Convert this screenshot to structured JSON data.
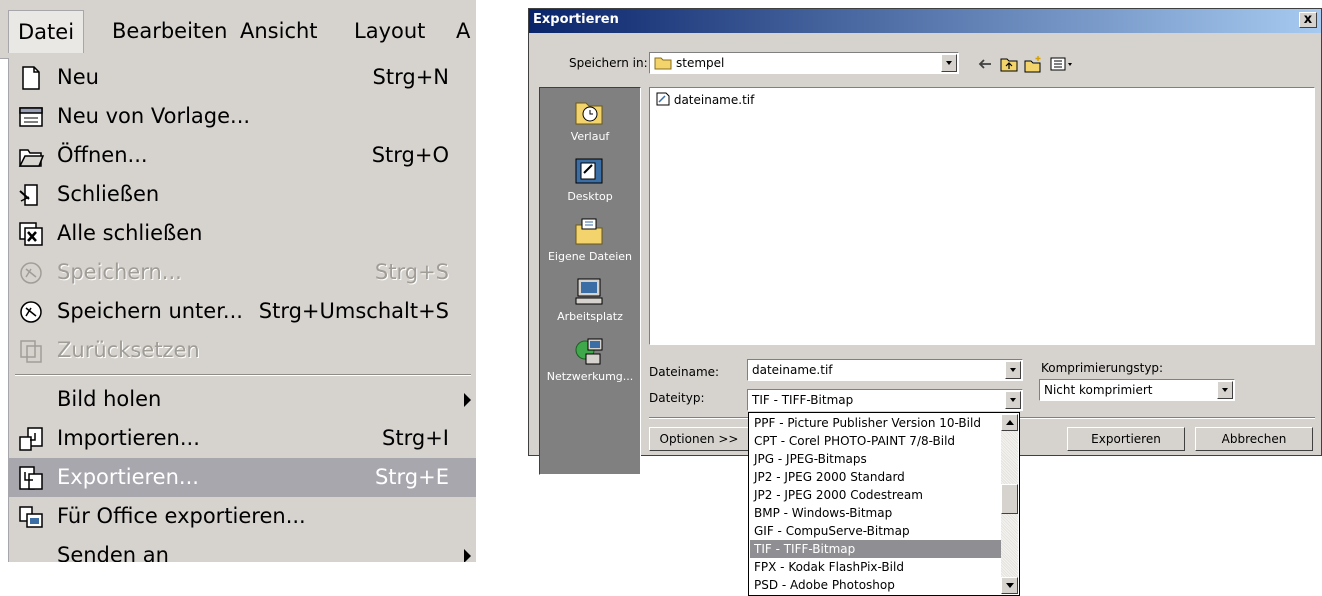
{
  "menubar": {
    "items": [
      {
        "label": "Datei"
      },
      {
        "label": "Bearbeiten"
      },
      {
        "label": "Ansicht"
      },
      {
        "label": "Layout"
      },
      {
        "label": "A"
      }
    ]
  },
  "menu": {
    "items": [
      {
        "icon": "new-document-icon",
        "label": "Neu",
        "shortcut": "Strg+N",
        "disabled": false
      },
      {
        "icon": "template-icon",
        "label": "Neu von Vorlage...",
        "shortcut": "",
        "disabled": false
      },
      {
        "icon": "open-folder-icon",
        "label": "Öffnen...",
        "shortcut": "Strg+O",
        "disabled": false
      },
      {
        "icon": "close-document-icon",
        "label": "Schließen",
        "shortcut": "",
        "disabled": false
      },
      {
        "icon": "close-all-icon",
        "label": "Alle schließen",
        "shortcut": "",
        "disabled": false
      },
      {
        "icon": "save-icon",
        "label": "Speichern...",
        "shortcut": "Strg+S",
        "disabled": true
      },
      {
        "icon": "save-as-icon",
        "label": "Speichern unter...",
        "shortcut": "Strg+Umschalt+S",
        "disabled": false
      },
      {
        "icon": "revert-icon",
        "label": "Zurücksetzen",
        "shortcut": "",
        "disabled": true
      },
      {
        "icon": "",
        "label": "Bild holen",
        "shortcut": "",
        "disabled": false,
        "submenu": true
      },
      {
        "icon": "import-icon",
        "label": "Importieren...",
        "shortcut": "Strg+I",
        "disabled": false
      },
      {
        "icon": "export-icon",
        "label": "Exportieren...",
        "shortcut": "Strg+E",
        "disabled": false,
        "highlighted": true
      },
      {
        "icon": "office-export-icon",
        "label": "Für Office exportieren...",
        "shortcut": "",
        "disabled": false
      },
      {
        "icon": "",
        "label": "Senden an",
        "shortcut": "",
        "disabled": false,
        "submenu": true
      }
    ]
  },
  "dialog": {
    "title": "Exportieren",
    "close_label": "x",
    "save_in_label": "Speichern in:",
    "save_in_value": "stempel",
    "places": [
      {
        "label": "Verlauf",
        "icon": "history-icon"
      },
      {
        "label": "Desktop",
        "icon": "desktop-icon"
      },
      {
        "label": "Eigene Dateien",
        "icon": "my-documents-icon"
      },
      {
        "label": "Arbeitsplatz",
        "icon": "my-computer-icon"
      },
      {
        "label": "Netzwerkumg...",
        "icon": "network-icon"
      }
    ],
    "files": [
      {
        "name": "dateiname.tif"
      }
    ],
    "filename_label": "Dateiname:",
    "filename_value": "dateiname.tif",
    "filetype_label": "Dateityp:",
    "filetype_value": "TIF - TIFF-Bitmap",
    "compression_label": "Komprimierungstyp:",
    "compression_value": "Nicht komprimiert",
    "options_button": "Optionen >>",
    "export_button": "Exportieren",
    "cancel_button": "Abbrechen",
    "filetype_options": [
      "PPF - Picture Publisher Version 10-Bild",
      "CPT - Corel PHOTO-PAINT 7/8-Bild",
      "JPG - JPEG-Bitmaps",
      "JP2 - JPEG 2000 Standard",
      "JP2 - JPEG 2000 Codestream",
      "BMP - Windows-Bitmap",
      "GIF - CompuServe-Bitmap",
      "TIF - TIFF-Bitmap",
      "FPX - Kodak FlashPix-Bild",
      "PSD - Adobe Photoshop"
    ],
    "filetype_selected_index": 7
  }
}
